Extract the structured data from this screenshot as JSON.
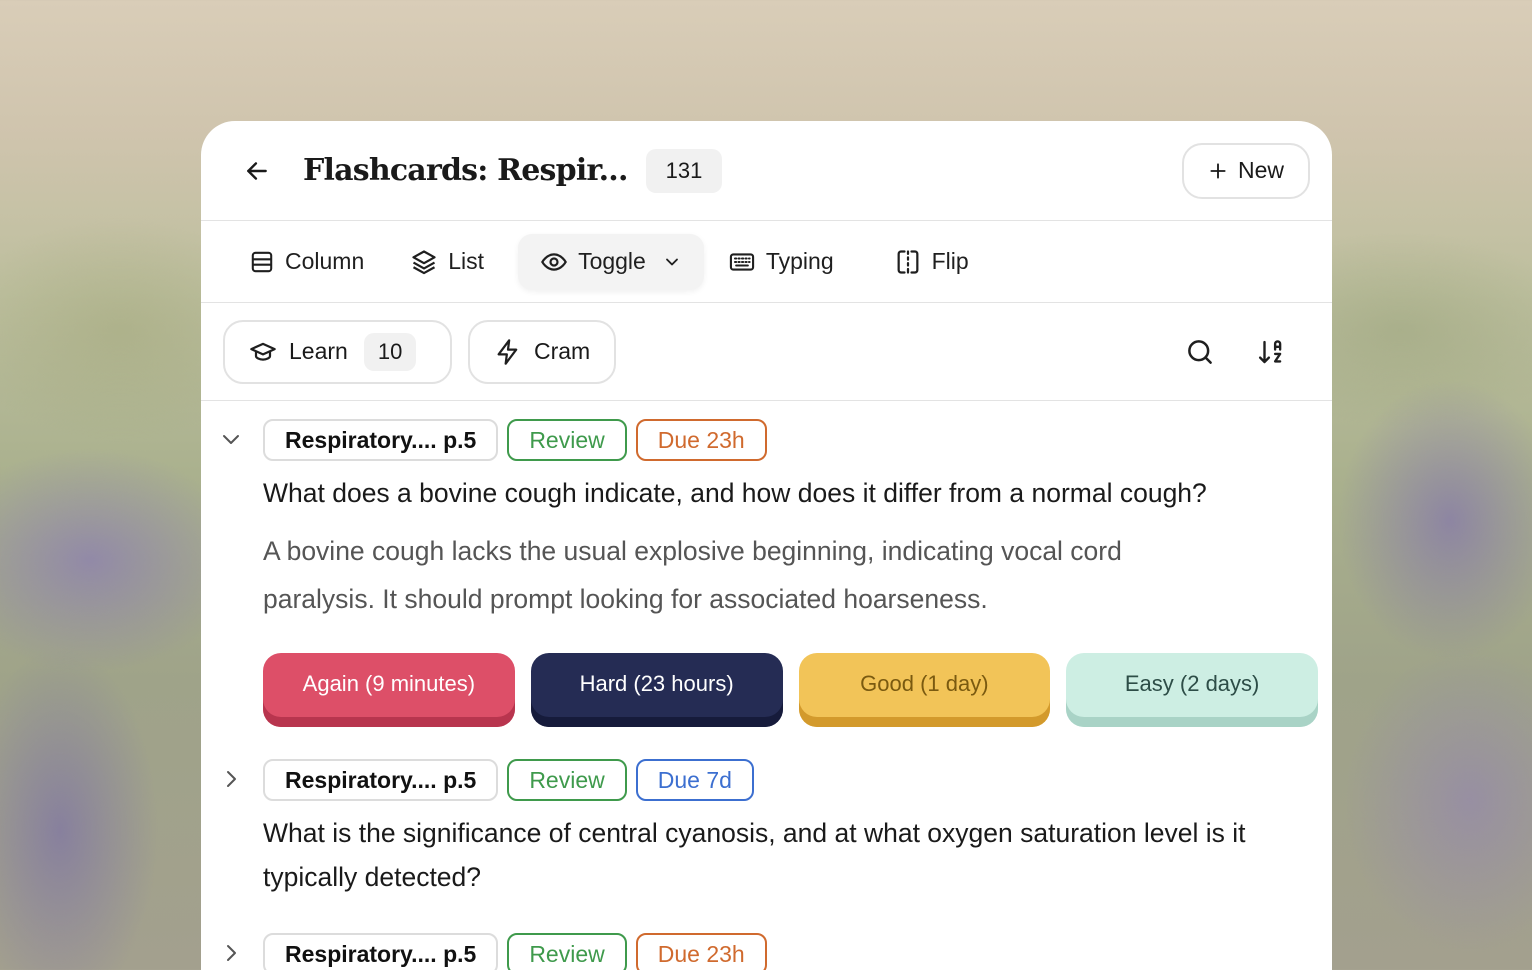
{
  "header": {
    "title": "Flashcards: Respir...",
    "count": "131",
    "new_label": "New"
  },
  "toolbar": {
    "items": [
      {
        "label": "Column",
        "icon": "column-icon"
      },
      {
        "label": "List",
        "icon": "layers-icon"
      },
      {
        "label": "Toggle",
        "icon": "eye-icon",
        "active": true
      },
      {
        "label": "Typing",
        "icon": "keyboard-icon"
      },
      {
        "label": "Flip",
        "icon": "flip-icon"
      }
    ]
  },
  "modes": {
    "learn_label": "Learn",
    "learn_count": "10",
    "cram_label": "Cram"
  },
  "cards": [
    {
      "source": "Respiratory.... p.5",
      "status": "Review",
      "due": "Due 23h",
      "expanded": true,
      "question": "What does a bovine cough indicate, and how does it differ from a normal cough?",
      "answer": "A bovine cough lacks the usual explosive beginning, indicating vocal cord paralysis. It should prompt looking for associated hoarseness.",
      "grades": {
        "again": "Again (9 minutes)",
        "hard": "Hard (23 hours)",
        "good": "Good (1 day)",
        "easy": "Easy (2 days)"
      }
    },
    {
      "source": "Respiratory.... p.5",
      "status": "Review",
      "due": "Due 7d",
      "expanded": false,
      "question": "What is the significance of central cyanosis, and at what oxygen saturation level is it typically detected?"
    },
    {
      "source": "Respiratory.... p.5",
      "status": "Review",
      "due": "Due 23h",
      "expanded": false
    }
  ],
  "colors": {
    "review": "#3f9a4c",
    "due_orange": "#d06a2e",
    "due_blue": "#3c6fd0",
    "again": "#dd4f68",
    "hard": "#252c54",
    "good": "#f2c458",
    "easy": "#cdeee3"
  }
}
